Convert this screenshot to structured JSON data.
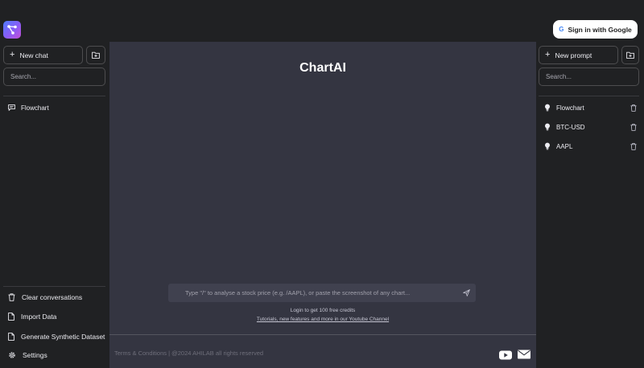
{
  "app": {
    "title": "ChartAI"
  },
  "header": {
    "signin_label": "Sign in with Google",
    "google_glyph": "G"
  },
  "left_sidebar": {
    "new_chat_label": "New chat",
    "search_placeholder": "Search...",
    "conversations": [
      {
        "label": "Flowchart",
        "icon": "chat-bubble-icon"
      }
    ],
    "bottom_items": [
      {
        "label": "Clear conversations",
        "icon": "trash-icon"
      },
      {
        "label": "Import Data",
        "icon": "file-icon"
      },
      {
        "label": "Generate Synthetic Dataset",
        "icon": "file-icon"
      },
      {
        "label": "Settings",
        "icon": "gear-icon"
      }
    ]
  },
  "right_sidebar": {
    "new_prompt_label": "New prompt",
    "search_placeholder": "Search...",
    "prompts": [
      {
        "label": "Flowchart",
        "icon": "lightbulb-icon"
      },
      {
        "label": "BTC-USD",
        "icon": "lightbulb-icon"
      },
      {
        "label": "AAPL",
        "icon": "lightbulb-icon"
      }
    ]
  },
  "main": {
    "prompt_placeholder": "Type \"/\" to analyse a stock price (e.g. /AAPL), or paste the screenshot of any chart...",
    "login_note": "Login to get 100 free credits",
    "tutorial_link": "Tutorials, new features and more in our Youtube Channel",
    "footer_text": "Terms & Conditions | @2024 AHILAB all rights reserved"
  },
  "colors": {
    "sidebar_bg": "#202123",
    "main_bg": "#343541",
    "input_bg": "#40414f",
    "logo_gradient_start": "#4f7cff",
    "logo_gradient_end": "#c44fd6"
  }
}
